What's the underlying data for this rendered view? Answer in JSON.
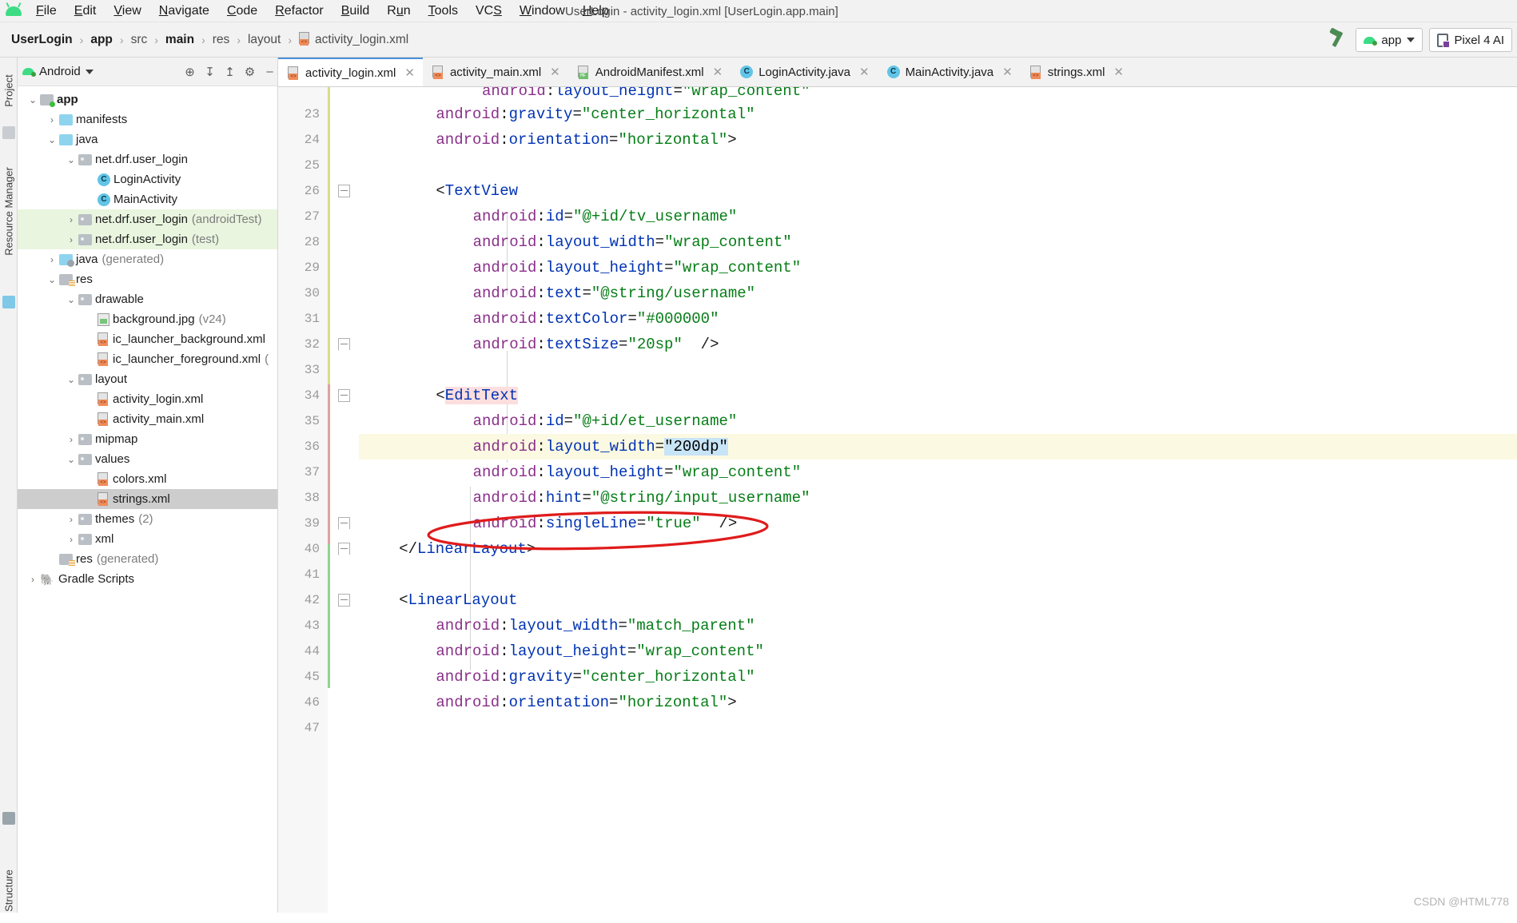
{
  "window": {
    "title": "UserLogin - activity_login.xml [UserLogin.app.main]"
  },
  "menubar": {
    "items": [
      {
        "label": "File",
        "mnemonic": "F"
      },
      {
        "label": "Edit",
        "mnemonic": "E"
      },
      {
        "label": "View",
        "mnemonic": "V"
      },
      {
        "label": "Navigate",
        "mnemonic": "N"
      },
      {
        "label": "Code",
        "mnemonic": "C"
      },
      {
        "label": "Refactor",
        "mnemonic": "R"
      },
      {
        "label": "Build",
        "mnemonic": "B"
      },
      {
        "label": "Run",
        "mnemonic": "u"
      },
      {
        "label": "Tools",
        "mnemonic": "T"
      },
      {
        "label": "VCS",
        "mnemonic": "S"
      },
      {
        "label": "Window",
        "mnemonic": "W"
      },
      {
        "label": "Help",
        "mnemonic": "H"
      }
    ]
  },
  "breadcrumb": {
    "items": [
      "UserLogin",
      "app",
      "src",
      "main",
      "res",
      "layout"
    ],
    "file": "activity_login.xml"
  },
  "toolbar": {
    "build_icon": "hammer-icon",
    "run_config": "app",
    "device": "Pixel 4 AI"
  },
  "left_strip": {
    "project_label": "Project",
    "resource_manager_label": "Resource Manager",
    "structure_label": "Structure"
  },
  "project_panel": {
    "title": "Android",
    "tree": [
      {
        "depth": 0,
        "twist": "v",
        "icon": "app-folder",
        "label": "app",
        "bold": true,
        "dim": "",
        "state": "normal"
      },
      {
        "depth": 1,
        "twist": ">",
        "icon": "blue-folder",
        "label": "manifests",
        "bold": false,
        "dim": "",
        "state": "normal"
      },
      {
        "depth": 1,
        "twist": "v",
        "icon": "blue-folder",
        "label": "java",
        "bold": false,
        "dim": "",
        "state": "normal"
      },
      {
        "depth": 2,
        "twist": "v",
        "icon": "package-folder",
        "label": "net.drf.user_login",
        "bold": false,
        "dim": "",
        "state": "normal"
      },
      {
        "depth": 3,
        "twist": "",
        "icon": "class",
        "label": "LoginActivity",
        "bold": false,
        "dim": "",
        "state": "normal"
      },
      {
        "depth": 3,
        "twist": "",
        "icon": "class",
        "label": "MainActivity",
        "bold": false,
        "dim": "",
        "state": "normal"
      },
      {
        "depth": 2,
        "twist": ">",
        "icon": "package-folder",
        "label": "net.drf.user_login",
        "bold": false,
        "dim": "(androidTest)",
        "state": "green"
      },
      {
        "depth": 2,
        "twist": ">",
        "icon": "package-folder",
        "label": "net.drf.user_login",
        "bold": false,
        "dim": "(test)",
        "state": "green"
      },
      {
        "depth": 1,
        "twist": ">",
        "icon": "generated-folder",
        "label": "java",
        "bold": false,
        "dim": "(generated)",
        "state": "normal"
      },
      {
        "depth": 1,
        "twist": "v",
        "icon": "res-folder",
        "label": "res",
        "bold": false,
        "dim": "",
        "state": "normal"
      },
      {
        "depth": 2,
        "twist": "v",
        "icon": "package-folder",
        "label": "drawable",
        "bold": false,
        "dim": "",
        "state": "normal"
      },
      {
        "depth": 3,
        "twist": "",
        "icon": "image",
        "label": "background.jpg",
        "bold": false,
        "dim": "(v24)",
        "state": "normal"
      },
      {
        "depth": 3,
        "twist": "",
        "icon": "xml",
        "label": "ic_launcher_background.xml",
        "bold": false,
        "dim": "",
        "state": "normal"
      },
      {
        "depth": 3,
        "twist": "",
        "icon": "xml",
        "label": "ic_launcher_foreground.xml",
        "bold": false,
        "dim": "(",
        "state": "normal"
      },
      {
        "depth": 2,
        "twist": "v",
        "icon": "package-folder",
        "label": "layout",
        "bold": false,
        "dim": "",
        "state": "normal"
      },
      {
        "depth": 3,
        "twist": "",
        "icon": "xml",
        "label": "activity_login.xml",
        "bold": false,
        "dim": "",
        "state": "normal"
      },
      {
        "depth": 3,
        "twist": "",
        "icon": "xml",
        "label": "activity_main.xml",
        "bold": false,
        "dim": "",
        "state": "normal"
      },
      {
        "depth": 2,
        "twist": ">",
        "icon": "package-folder",
        "label": "mipmap",
        "bold": false,
        "dim": "",
        "state": "normal"
      },
      {
        "depth": 2,
        "twist": "v",
        "icon": "package-folder",
        "label": "values",
        "bold": false,
        "dim": "",
        "state": "normal"
      },
      {
        "depth": 3,
        "twist": "",
        "icon": "xml",
        "label": "colors.xml",
        "bold": false,
        "dim": "",
        "state": "normal"
      },
      {
        "depth": 3,
        "twist": "",
        "icon": "xml",
        "label": "strings.xml",
        "bold": false,
        "dim": "",
        "state": "selected"
      },
      {
        "depth": 2,
        "twist": ">",
        "icon": "package-folder",
        "label": "themes",
        "bold": false,
        "dim": "(2)",
        "state": "normal"
      },
      {
        "depth": 2,
        "twist": ">",
        "icon": "package-folder",
        "label": "xml",
        "bold": false,
        "dim": "",
        "state": "normal"
      },
      {
        "depth": 1,
        "twist": "",
        "icon": "res-folder",
        "label": "res",
        "bold": false,
        "dim": "(generated)",
        "state": "normal"
      },
      {
        "depth": 0,
        "twist": ">",
        "icon": "gradle",
        "label": "Gradle Scripts",
        "bold": false,
        "dim": "",
        "state": "normal"
      }
    ]
  },
  "editor_tabs": [
    {
      "label": "activity_login.xml",
      "icon": "xml-file-icon",
      "active": true
    },
    {
      "label": "activity_main.xml",
      "icon": "xml-file-icon",
      "active": false
    },
    {
      "label": "AndroidManifest.xml",
      "icon": "manifest-file-icon",
      "active": false
    },
    {
      "label": "LoginActivity.java",
      "icon": "class-icon",
      "active": false
    },
    {
      "label": "MainActivity.java",
      "icon": "class-icon",
      "active": false
    },
    {
      "label": "strings.xml",
      "icon": "xml-file-icon",
      "active": false
    }
  ],
  "editor": {
    "first_line": 23,
    "color_swatch_line": 31,
    "color_swatch_hex": "#000000",
    "highlighted_line": 36,
    "lines": [
      {
        "n": 23,
        "indent": 8,
        "segments": [
          {
            "t": "attr",
            "s": "android"
          },
          {
            "t": "punct",
            "s": ":"
          },
          {
            "t": "ns",
            "s": "gravity"
          },
          {
            "t": "punct",
            "s": "="
          },
          {
            "t": "val",
            "s": "\"center_horizontal\""
          }
        ]
      },
      {
        "n": 24,
        "indent": 8,
        "segments": [
          {
            "t": "attr",
            "s": "android"
          },
          {
            "t": "punct",
            "s": ":"
          },
          {
            "t": "ns",
            "s": "orientation"
          },
          {
            "t": "punct",
            "s": "="
          },
          {
            "t": "val",
            "s": "\"horizontal\""
          },
          {
            "t": "punct",
            "s": ">"
          }
        ]
      },
      {
        "n": 25,
        "indent": 0,
        "segments": []
      },
      {
        "n": 26,
        "indent": 8,
        "segments": [
          {
            "t": "punct",
            "s": "<"
          },
          {
            "t": "tag",
            "s": "TextView"
          }
        ]
      },
      {
        "n": 27,
        "indent": 12,
        "segments": [
          {
            "t": "attr",
            "s": "android"
          },
          {
            "t": "punct",
            "s": ":"
          },
          {
            "t": "ns",
            "s": "id"
          },
          {
            "t": "punct",
            "s": "="
          },
          {
            "t": "val",
            "s": "\"@+id/tv_username\""
          }
        ]
      },
      {
        "n": 28,
        "indent": 12,
        "segments": [
          {
            "t": "attr",
            "s": "android"
          },
          {
            "t": "punct",
            "s": ":"
          },
          {
            "t": "ns",
            "s": "layout_width"
          },
          {
            "t": "punct",
            "s": "="
          },
          {
            "t": "val",
            "s": "\"wrap_content\""
          }
        ]
      },
      {
        "n": 29,
        "indent": 12,
        "segments": [
          {
            "t": "attr",
            "s": "android"
          },
          {
            "t": "punct",
            "s": ":"
          },
          {
            "t": "ns",
            "s": "layout_height"
          },
          {
            "t": "punct",
            "s": "="
          },
          {
            "t": "val",
            "s": "\"wrap_content\""
          }
        ]
      },
      {
        "n": 30,
        "indent": 12,
        "segments": [
          {
            "t": "attr",
            "s": "android"
          },
          {
            "t": "punct",
            "s": ":"
          },
          {
            "t": "ns",
            "s": "text"
          },
          {
            "t": "punct",
            "s": "="
          },
          {
            "t": "val",
            "s": "\"@string/username\""
          }
        ]
      },
      {
        "n": 31,
        "indent": 12,
        "segments": [
          {
            "t": "attr",
            "s": "android"
          },
          {
            "t": "punct",
            "s": ":"
          },
          {
            "t": "ns",
            "s": "textColor"
          },
          {
            "t": "punct",
            "s": "="
          },
          {
            "t": "val",
            "s": "\"#000000\""
          }
        ]
      },
      {
        "n": 32,
        "indent": 12,
        "segments": [
          {
            "t": "attr",
            "s": "android"
          },
          {
            "t": "punct",
            "s": ":"
          },
          {
            "t": "ns",
            "s": "textSize"
          },
          {
            "t": "punct",
            "s": "="
          },
          {
            "t": "val",
            "s": "\"20sp\""
          },
          {
            "t": "punct",
            "s": "  />"
          }
        ]
      },
      {
        "n": 33,
        "indent": 0,
        "segments": []
      },
      {
        "n": 34,
        "indent": 8,
        "segments": [
          {
            "t": "punct",
            "s": "<"
          },
          {
            "t": "tagpink",
            "s": "EditText"
          }
        ]
      },
      {
        "n": 35,
        "indent": 12,
        "segments": [
          {
            "t": "attr",
            "s": "android"
          },
          {
            "t": "punct",
            "s": ":"
          },
          {
            "t": "ns",
            "s": "id"
          },
          {
            "t": "punct",
            "s": "="
          },
          {
            "t": "val",
            "s": "\"@+id/et_username\""
          }
        ]
      },
      {
        "n": 36,
        "indent": 12,
        "hl": true,
        "segments": [
          {
            "t": "attr",
            "s": "android"
          },
          {
            "t": "punct",
            "s": ":"
          },
          {
            "t": "ns",
            "s": "layout_width"
          },
          {
            "t": "punct",
            "s": "="
          },
          {
            "t": "selval",
            "s": "\"200dp\""
          }
        ]
      },
      {
        "n": 37,
        "indent": 12,
        "segments": [
          {
            "t": "attr",
            "s": "android"
          },
          {
            "t": "punct",
            "s": ":"
          },
          {
            "t": "ns",
            "s": "layout_height"
          },
          {
            "t": "punct",
            "s": "="
          },
          {
            "t": "val",
            "s": "\"wrap_content\""
          }
        ]
      },
      {
        "n": 38,
        "indent": 12,
        "segments": [
          {
            "t": "attr",
            "s": "android"
          },
          {
            "t": "punct",
            "s": ":"
          },
          {
            "t": "ns",
            "s": "hint"
          },
          {
            "t": "punct",
            "s": "="
          },
          {
            "t": "val",
            "s": "\"@string/input_username\""
          }
        ]
      },
      {
        "n": 39,
        "indent": 12,
        "segments": [
          {
            "t": "attr",
            "s": "android"
          },
          {
            "t": "punct",
            "s": ":"
          },
          {
            "t": "ns",
            "s": "singleLine"
          },
          {
            "t": "punct",
            "s": "="
          },
          {
            "t": "val",
            "s": "\"true\""
          },
          {
            "t": "punct",
            "s": "  />"
          }
        ]
      },
      {
        "n": 40,
        "indent": 4,
        "segments": [
          {
            "t": "punct",
            "s": "</"
          },
          {
            "t": "tag",
            "s": "LinearLayout"
          },
          {
            "t": "punct",
            "s": ">"
          }
        ]
      },
      {
        "n": 41,
        "indent": 0,
        "segments": []
      },
      {
        "n": 42,
        "indent": 4,
        "segments": [
          {
            "t": "punct",
            "s": "<"
          },
          {
            "t": "tag",
            "s": "LinearLayout"
          }
        ]
      },
      {
        "n": 43,
        "indent": 8,
        "segments": [
          {
            "t": "attr",
            "s": "android"
          },
          {
            "t": "punct",
            "s": ":"
          },
          {
            "t": "ns",
            "s": "layout_width"
          },
          {
            "t": "punct",
            "s": "="
          },
          {
            "t": "val",
            "s": "\"match_parent\""
          }
        ]
      },
      {
        "n": 44,
        "indent": 8,
        "segments": [
          {
            "t": "attr",
            "s": "android"
          },
          {
            "t": "punct",
            "s": ":"
          },
          {
            "t": "ns",
            "s": "layout_height"
          },
          {
            "t": "punct",
            "s": "="
          },
          {
            "t": "val",
            "s": "\"wrap_content\""
          }
        ]
      },
      {
        "n": 45,
        "indent": 8,
        "segments": [
          {
            "t": "attr",
            "s": "android"
          },
          {
            "t": "punct",
            "s": ":"
          },
          {
            "t": "ns",
            "s": "gravity"
          },
          {
            "t": "punct",
            "s": "="
          },
          {
            "t": "val",
            "s": "\"center_horizontal\""
          }
        ]
      },
      {
        "n": 46,
        "indent": 8,
        "segments": [
          {
            "t": "attr",
            "s": "android"
          },
          {
            "t": "punct",
            "s": ":"
          },
          {
            "t": "ns",
            "s": "orientation"
          },
          {
            "t": "punct",
            "s": "="
          },
          {
            "t": "val",
            "s": "\"horizontal\""
          },
          {
            "t": "punct",
            "s": ">"
          }
        ]
      },
      {
        "n": 47,
        "indent": 0,
        "segments": []
      }
    ]
  },
  "annotation": {
    "shape": "red-ellipse",
    "color": "#e01b1b",
    "target_text": "android:layout_width=\"200dp\""
  },
  "watermark": "CSDN @HTML778",
  "colors": {
    "accent_blue": "#0033b3",
    "attr_purple": "#8a2f8a",
    "string_green": "#067d17",
    "selection_blue": "#c8e4f7",
    "line_highlight": "#fcf9e2",
    "android_green": "#3ddc84"
  }
}
